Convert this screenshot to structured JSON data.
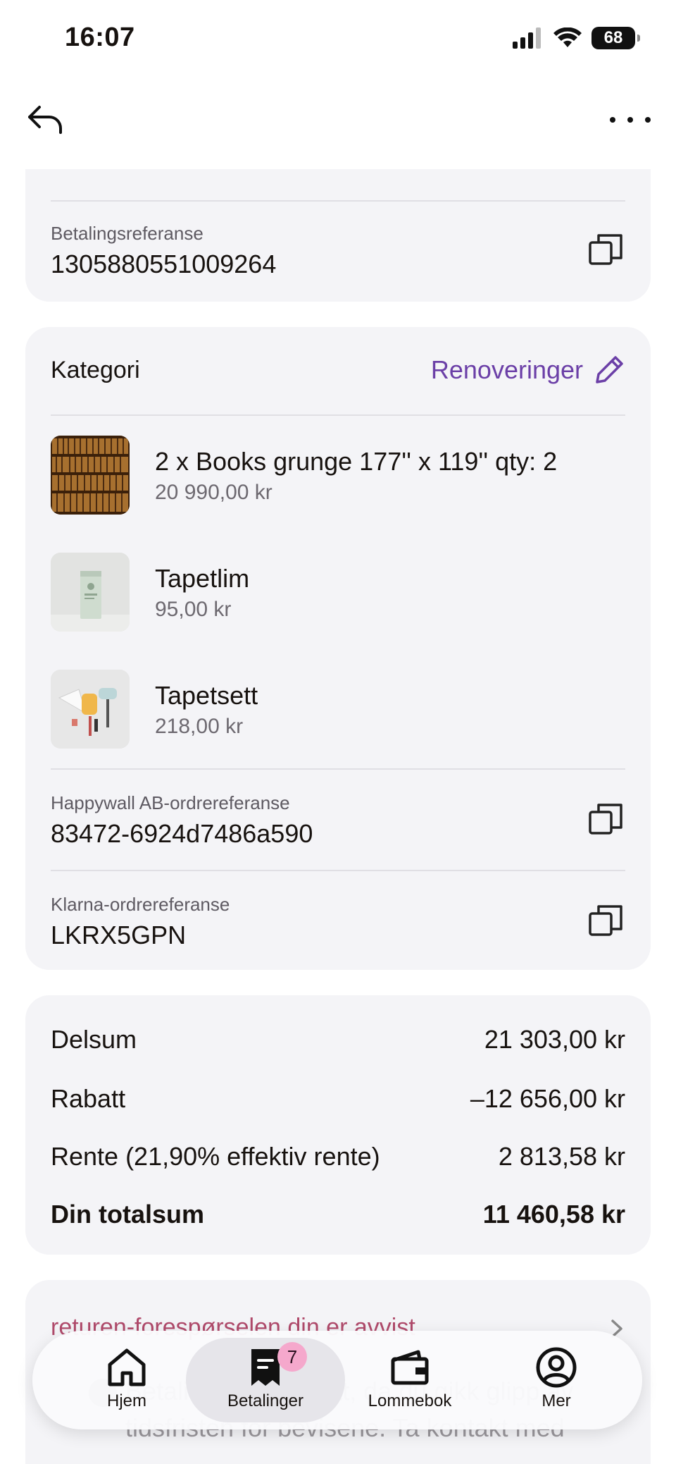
{
  "status_bar": {
    "time": "16:07",
    "battery": "68"
  },
  "payment_reference": {
    "label": "Betalingsreferanse",
    "value": "1305880551009264"
  },
  "category": {
    "label": "Kategori",
    "value": "Renoveringer"
  },
  "items": [
    {
      "name": "2 x Books grunge 177'' x 119''  qty: 2",
      "price": "20 990,00 kr"
    },
    {
      "name": "Tapetlim",
      "price": "95,00 kr"
    },
    {
      "name": "Tapetsett",
      "price": "218,00 kr"
    }
  ],
  "merchant_reference": {
    "label": "Happywall AB-ordrereferanse",
    "value": "83472-6924d7486a590"
  },
  "klarna_reference": {
    "label": "Klarna-ordrereferanse",
    "value": "LKRX5GPN"
  },
  "summary": {
    "subtotal": {
      "label": "Delsum",
      "value": "21 303,00 kr"
    },
    "discount": {
      "label": "Rabatt",
      "value": "–12 656,00 kr"
    },
    "interest": {
      "label": "Rente (21,90% effektiv rente)",
      "value": "2 813,58 kr"
    },
    "total": {
      "label": "Din totalsum",
      "value": "11 460,58 kr"
    }
  },
  "return_notice": {
    "title": "returen-forespørselen din er avvist",
    "message": "Betaling gjenopptatt, da du gikk glipp av tidsfristen for bevisene. Ta kontakt med"
  },
  "tabbar": {
    "tabs": [
      {
        "label": "Hjem",
        "icon": "home-icon"
      },
      {
        "label": "Betalinger",
        "icon": "receipt-icon",
        "badge": "7"
      },
      {
        "label": "Lommebok",
        "icon": "wallet-icon"
      },
      {
        "label": "Mer",
        "icon": "profile-icon"
      }
    ]
  },
  "colors": {
    "accent": "#6b3fa7",
    "badge": "#f5a8cc",
    "card": "#f4f4f7",
    "error_text": "#b04a6b"
  }
}
